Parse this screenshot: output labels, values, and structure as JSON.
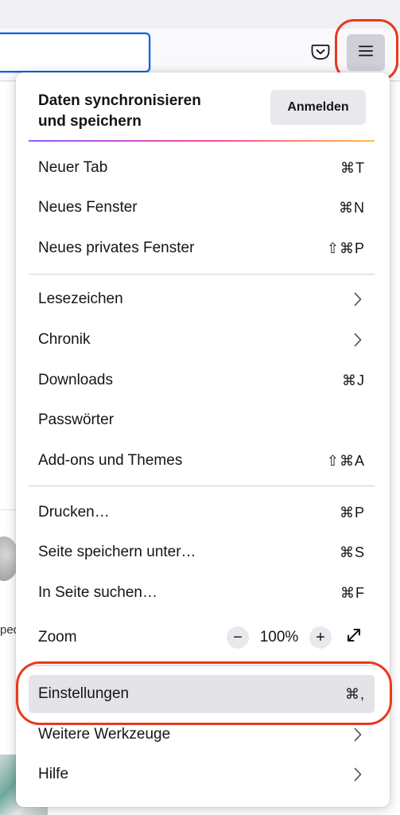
{
  "sync": {
    "title": "Daten synchronisieren und speichern",
    "signin_label": "Anmelden"
  },
  "menu": {
    "new_tab": {
      "label": "Neuer Tab",
      "shortcut": "⌘T"
    },
    "new_window": {
      "label": "Neues Fenster",
      "shortcut": "⌘N"
    },
    "new_private_window": {
      "label": "Neues privates Fenster",
      "shortcut": "⇧⌘P"
    },
    "bookmarks": {
      "label": "Lesezeichen"
    },
    "history": {
      "label": "Chronik"
    },
    "downloads": {
      "label": "Downloads",
      "shortcut": "⌘J"
    },
    "passwords": {
      "label": "Passwörter"
    },
    "addons": {
      "label": "Add-ons und Themes",
      "shortcut": "⇧⌘A"
    },
    "print": {
      "label": "Drucken…",
      "shortcut": "⌘P"
    },
    "save_page": {
      "label": "Seite speichern unter…",
      "shortcut": "⌘S"
    },
    "find": {
      "label": "In Seite suchen…",
      "shortcut": "⌘F"
    },
    "zoom": {
      "label": "Zoom",
      "minus": "−",
      "value": "100%",
      "plus": "+"
    },
    "settings": {
      "label": "Einstellungen",
      "shortcut": "⌘,"
    },
    "more_tools": {
      "label": "Weitere Werkzeuge"
    },
    "help": {
      "label": "Hilfe"
    }
  },
  "background": {
    "snippet": "ped"
  },
  "icons": {
    "menu": "hamburger-menu-icon",
    "pocket": "pocket-icon",
    "chevron": "chevron-right-icon",
    "fullscreen": "fullscreen-arrows-icon"
  },
  "colors": {
    "highlight": "#e8391d",
    "url_focus": "#0061e0",
    "gradient": [
      "#9059ff",
      "#ff4aa2",
      "#ffbd4f"
    ],
    "active_item": "#e4e4e8"
  }
}
